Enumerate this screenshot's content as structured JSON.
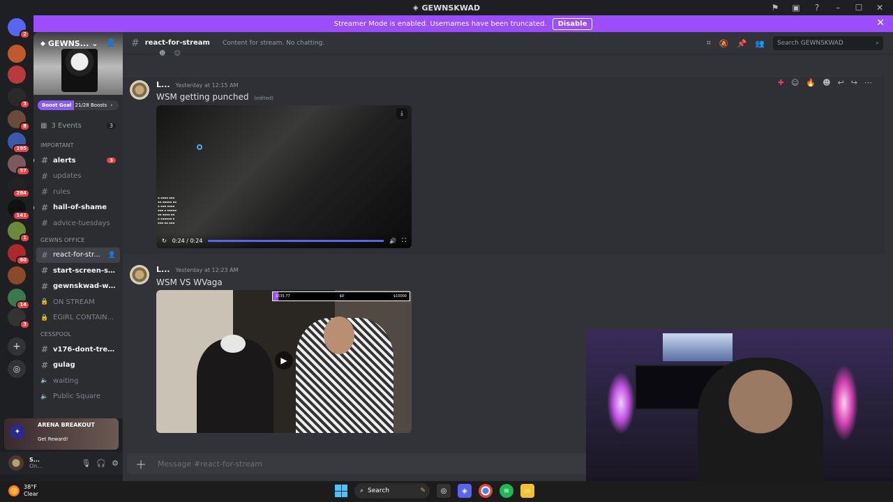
{
  "window": {
    "title": "GEWNSKWAD"
  },
  "banner": {
    "text": "Streamer Mode is enabled. Usernames have been truncated.",
    "button": "Disable"
  },
  "servers": [
    {
      "name": "dm",
      "badge": "2",
      "color": "#5865f2"
    },
    {
      "name": "s1",
      "badge": "",
      "color": "#c05a2a"
    },
    {
      "name": "s2",
      "badge": "",
      "color": "#b83a3a"
    },
    {
      "name": "gewns",
      "badge": "3",
      "color": "#2a2a2a"
    },
    {
      "name": "s4",
      "badge": "8",
      "color": "#6a4a3a"
    },
    {
      "name": "s5",
      "badge": "195",
      "color": "#3a5aaa"
    },
    {
      "name": "s6",
      "badge": "57",
      "color": "#7a5a5a"
    },
    {
      "name": "s7",
      "badge": "284",
      "color": "#222"
    },
    {
      "name": "s8",
      "badge": "141",
      "color": "#111"
    },
    {
      "name": "s9",
      "badge": "1",
      "color": "#6a8a3a"
    },
    {
      "name": "s10",
      "badge": "60",
      "color": "#aa2a2a"
    },
    {
      "name": "s11",
      "badge": "",
      "color": "#8a4a2a"
    },
    {
      "name": "s12",
      "badge": "14",
      "color": "#3a7a4a"
    },
    {
      "name": "s13",
      "badge": "3",
      "color": "#333"
    }
  ],
  "guild": {
    "name": "GEWNS...",
    "boost_goal": "Boost Goal",
    "boost_count": "21/28 Boosts",
    "events_label": "3 Events",
    "events_count": "3"
  },
  "categories": {
    "important": "IMPORTANT",
    "office": "GEWNS OFFICE",
    "cesspool": "CESSPOOL"
  },
  "channels_important": [
    {
      "label": "alerts",
      "unread": true,
      "count": "3",
      "dot": true
    },
    {
      "label": "updates",
      "unread": false,
      "count": ""
    },
    {
      "label": "rules",
      "unread": false,
      "count": ""
    },
    {
      "label": "hall-of-shame",
      "unread": true,
      "count": "",
      "dot": true
    },
    {
      "label": "advice-tuesdays",
      "unread": false,
      "count": ""
    }
  ],
  "channels_office": [
    {
      "label": "react-for-str...",
      "active": true
    },
    {
      "label": "start-screen-su...",
      "unread": true
    },
    {
      "label": "gewnskwad-win...",
      "unread": true
    },
    {
      "label": "ON STREAM",
      "locked": true
    },
    {
      "label": "EGIRL CONTAIN...",
      "locked": true
    }
  ],
  "channels_cesspool": [
    {
      "label": "v176-dont-tread...",
      "unread": true
    },
    {
      "label": "gulag",
      "unread": true
    },
    {
      "label": "waiting",
      "voice": true
    },
    {
      "label": "Public Square",
      "voice": true
    }
  ],
  "promo": {
    "brand": "ARENA BREAKOUT",
    "reward": "Get Reward!"
  },
  "user": {
    "name": "S...",
    "status": "On..."
  },
  "channel_header": {
    "name": "react-for-stream",
    "topic": "Content for stream. No chatting.",
    "search_placeholder": "Search GEWNSKWAD"
  },
  "messages": [
    {
      "author": "L...",
      "time": "Yesterday at 12:15 AM",
      "text": "WSM getting punched",
      "edited": "(edited)",
      "video_time": "0:24 / 0:24"
    },
    {
      "author": "L...",
      "time": "Yesterday at 12:23 AM",
      "text": "WSM VS WVaga",
      "goal_left": "$535.77",
      "goal_mid": "$0",
      "goal_right": "$10000"
    }
  ],
  "composer": {
    "placeholder": "Message #react-for-stream"
  },
  "taskbar": {
    "temp": "38°F",
    "condition": "Clear",
    "search": "Search"
  }
}
